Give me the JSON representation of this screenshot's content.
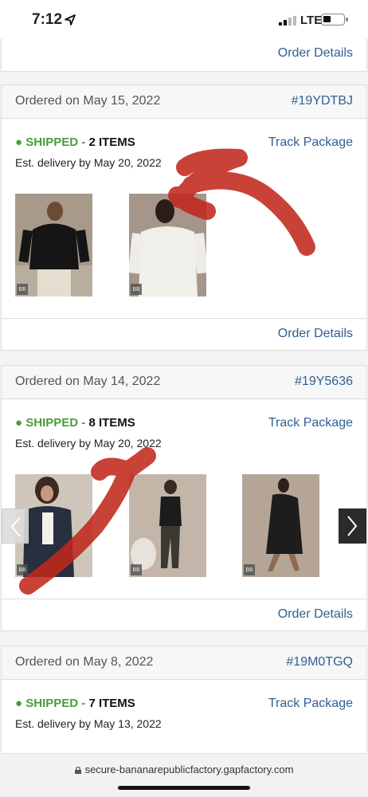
{
  "status_bar": {
    "time": "7:12",
    "network": "LTE"
  },
  "orders": [
    {
      "details_label": "Order Details"
    },
    {
      "ordered": "Ordered on May 15, 2022",
      "order_number": "#19YDTBJ",
      "status": "SHIPPED",
      "separator": "-",
      "items": "2 ITEMS",
      "est_delivery": "Est. delivery by May 20, 2022",
      "track_label": "Track Package",
      "details_label": "Order Details"
    },
    {
      "ordered": "Ordered on May 14, 2022",
      "order_number": "#19Y5636",
      "status": "SHIPPED",
      "separator": "-",
      "items": "8 ITEMS",
      "est_delivery": "Est. delivery by May 20, 2022",
      "track_label": "Track Package",
      "details_label": "Order Details"
    },
    {
      "ordered": "Ordered on May 8, 2022",
      "order_number": "#19M0TGQ",
      "status": "SHIPPED",
      "separator": "-",
      "items": "7 ITEMS",
      "est_delivery": "Est. delivery by May 13, 2022",
      "track_label": "Track Package"
    }
  ],
  "product_logo": "BR",
  "url_bar": {
    "url": "secure-bananarepublicfactory.gapfactory.com"
  },
  "colors": {
    "link": "#2f5f92",
    "shipped": "#4a9d3a",
    "annotation": "#c0281c"
  },
  "icons": [
    "location-arrow-icon",
    "signal-icon",
    "battery-icon",
    "chevron-left-icon",
    "chevron-right-icon",
    "lock-icon"
  ]
}
